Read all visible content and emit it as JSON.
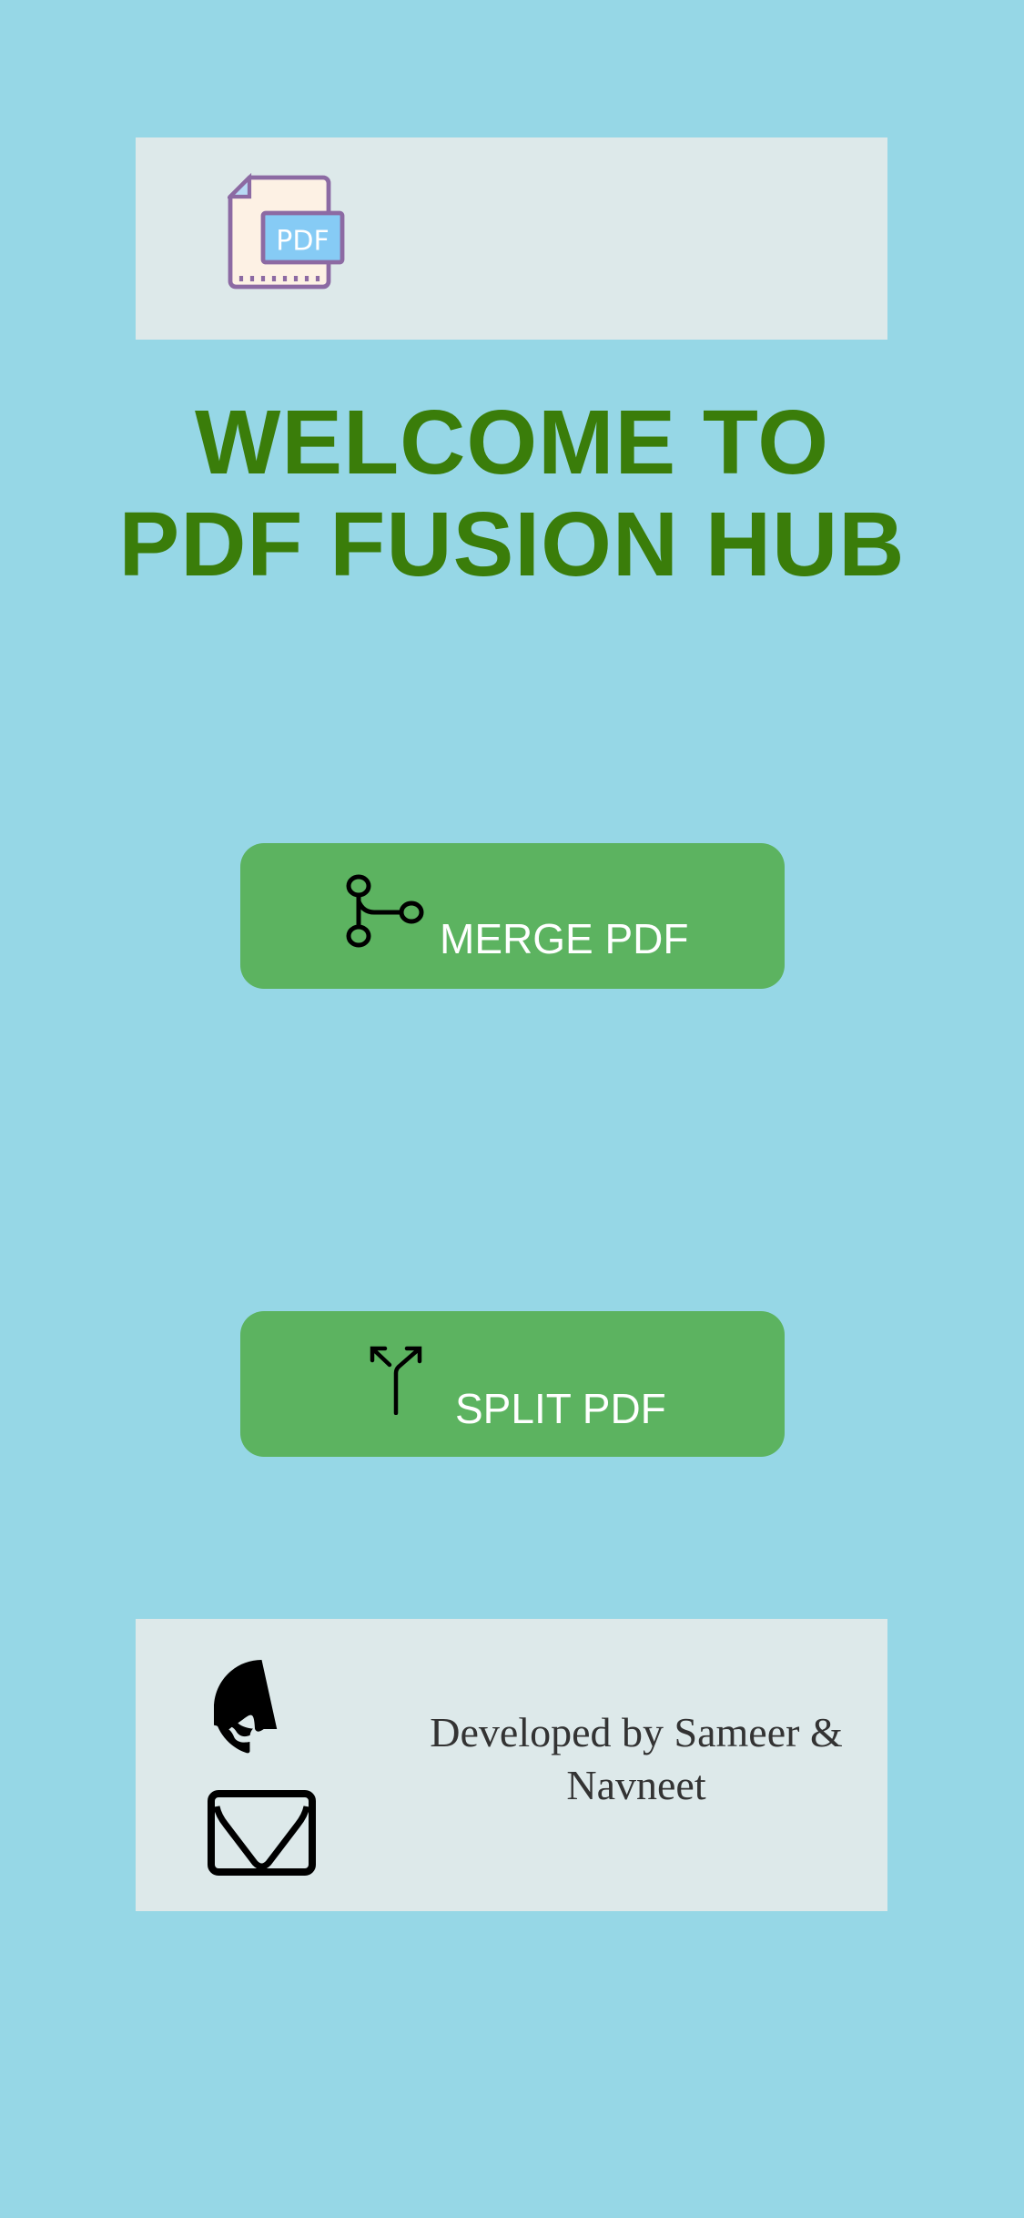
{
  "header": {
    "logo_text": "PDF",
    "logo_icon": "pdf-file-icon"
  },
  "title": {
    "line1": "WELCOME TO",
    "line2": "PDF FUSION HUB"
  },
  "buttons": {
    "merge": {
      "label": "MERGE PDF",
      "icon": "merge-icon"
    },
    "split": {
      "label": "SPLIT PDF",
      "icon": "split-icon"
    }
  },
  "footer": {
    "credit_line1": "Developed by Sameer &",
    "credit_line2": "Navneet",
    "icons": [
      "github-icon",
      "mail-icon"
    ]
  },
  "colors": {
    "background": "#96d7e6",
    "panel": "#dde9ea",
    "title": "#3a7d0a",
    "button": "#5cb360"
  }
}
